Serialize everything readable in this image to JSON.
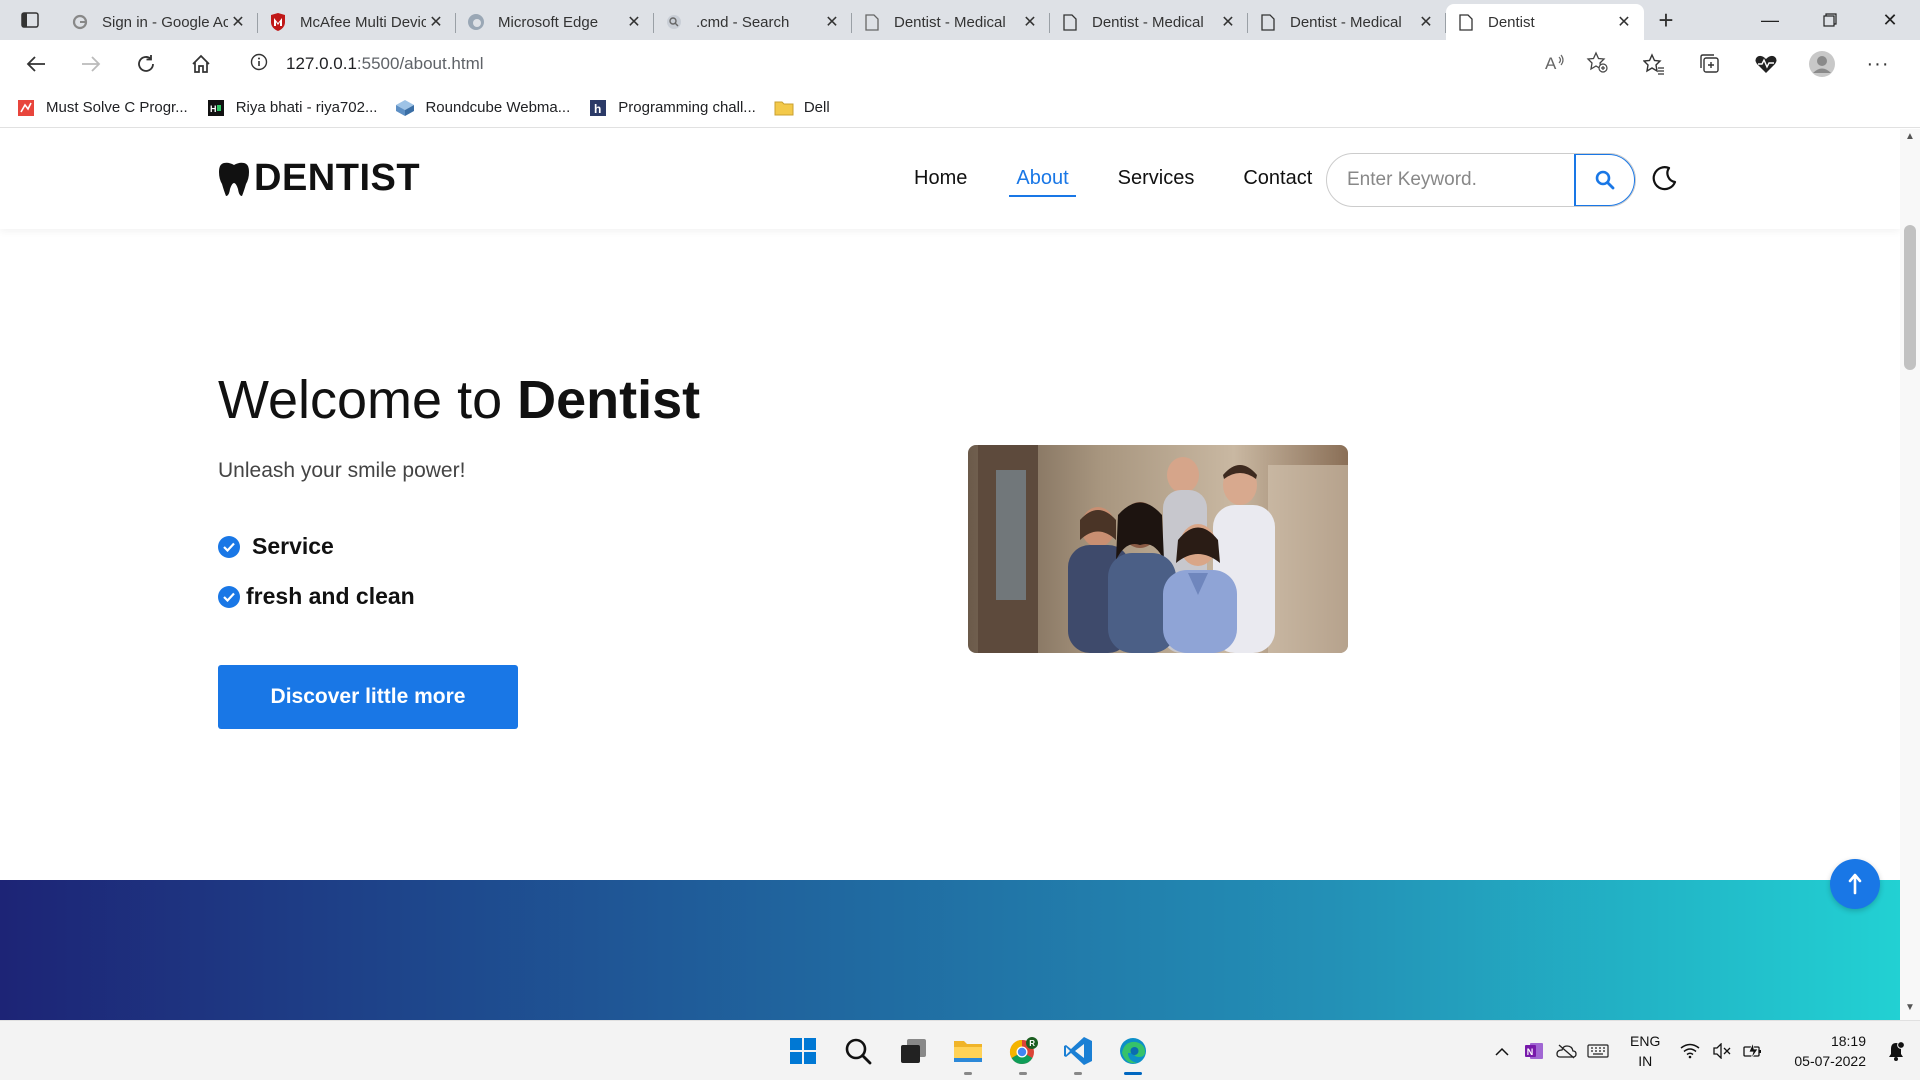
{
  "browser": {
    "tabs": [
      {
        "title": "Sign in - Google Accounts",
        "icon": "google-icon"
      },
      {
        "title": "McAfee Multi Device Security",
        "icon": "mcafee-icon"
      },
      {
        "title": "Microsoft Edge",
        "icon": "edge-icon"
      },
      {
        "title": ".cmd - Search",
        "icon": "search-icon"
      },
      {
        "title": "Dentist - Medical",
        "icon": "page-icon"
      },
      {
        "title": "Dentist - Medical",
        "icon": "page-icon"
      },
      {
        "title": "Dentist - Medical",
        "icon": "page-icon"
      },
      {
        "title": "Dentist",
        "icon": "page-icon",
        "active": true
      }
    ],
    "url_host": "127.0.0.1",
    "url_path": ":5500/about.html",
    "bookmarks": [
      {
        "label": "Must Solve C Progr...",
        "icon": "bookmark-red-icon"
      },
      {
        "label": "Riya bhati - riya702...",
        "icon": "hackerrank-icon"
      },
      {
        "label": "Roundcube Webma...",
        "icon": "roundcube-icon"
      },
      {
        "label": "Programming chall...",
        "icon": "h-icon"
      },
      {
        "label": "Dell",
        "icon": "folder-icon"
      }
    ]
  },
  "site": {
    "logo": "DENTIST",
    "nav": [
      "Home",
      "About",
      "Services",
      "Contact"
    ],
    "active_nav": "About",
    "search_placeholder": "Enter Keyword.",
    "hero": {
      "title_light": "Welcome to ",
      "title_bold": "Dentist",
      "subtitle": "Unleash your smile power!",
      "features": [
        "Service",
        "fresh and clean"
      ],
      "cta": "Discover little more"
    },
    "colors": {
      "accent": "#1977e6",
      "band_start": "#1d2476",
      "band_end": "#22d1d3"
    }
  },
  "taskbar": {
    "lang_top": "ENG",
    "lang_bottom": "IN",
    "time": "18:19",
    "date": "05-07-2022"
  }
}
